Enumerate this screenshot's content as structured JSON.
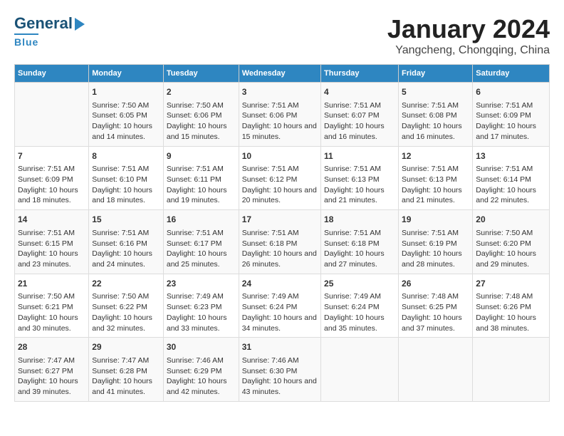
{
  "header": {
    "logo_line1": "General",
    "logo_line2": "Blue",
    "title": "January 2024",
    "subtitle": "Yangcheng, Chongqing, China"
  },
  "columns": [
    "Sunday",
    "Monday",
    "Tuesday",
    "Wednesday",
    "Thursday",
    "Friday",
    "Saturday"
  ],
  "weeks": [
    [
      {
        "day": "",
        "info": ""
      },
      {
        "day": "1",
        "info": "Sunrise: 7:50 AM\nSunset: 6:05 PM\nDaylight: 10 hours and 14 minutes."
      },
      {
        "day": "2",
        "info": "Sunrise: 7:50 AM\nSunset: 6:06 PM\nDaylight: 10 hours and 15 minutes."
      },
      {
        "day": "3",
        "info": "Sunrise: 7:51 AM\nSunset: 6:06 PM\nDaylight: 10 hours and 15 minutes."
      },
      {
        "day": "4",
        "info": "Sunrise: 7:51 AM\nSunset: 6:07 PM\nDaylight: 10 hours and 16 minutes."
      },
      {
        "day": "5",
        "info": "Sunrise: 7:51 AM\nSunset: 6:08 PM\nDaylight: 10 hours and 16 minutes."
      },
      {
        "day": "6",
        "info": "Sunrise: 7:51 AM\nSunset: 6:09 PM\nDaylight: 10 hours and 17 minutes."
      }
    ],
    [
      {
        "day": "7",
        "info": "Sunrise: 7:51 AM\nSunset: 6:09 PM\nDaylight: 10 hours and 18 minutes."
      },
      {
        "day": "8",
        "info": "Sunrise: 7:51 AM\nSunset: 6:10 PM\nDaylight: 10 hours and 18 minutes."
      },
      {
        "day": "9",
        "info": "Sunrise: 7:51 AM\nSunset: 6:11 PM\nDaylight: 10 hours and 19 minutes."
      },
      {
        "day": "10",
        "info": "Sunrise: 7:51 AM\nSunset: 6:12 PM\nDaylight: 10 hours and 20 minutes."
      },
      {
        "day": "11",
        "info": "Sunrise: 7:51 AM\nSunset: 6:13 PM\nDaylight: 10 hours and 21 minutes."
      },
      {
        "day": "12",
        "info": "Sunrise: 7:51 AM\nSunset: 6:13 PM\nDaylight: 10 hours and 21 minutes."
      },
      {
        "day": "13",
        "info": "Sunrise: 7:51 AM\nSunset: 6:14 PM\nDaylight: 10 hours and 22 minutes."
      }
    ],
    [
      {
        "day": "14",
        "info": "Sunrise: 7:51 AM\nSunset: 6:15 PM\nDaylight: 10 hours and 23 minutes."
      },
      {
        "day": "15",
        "info": "Sunrise: 7:51 AM\nSunset: 6:16 PM\nDaylight: 10 hours and 24 minutes."
      },
      {
        "day": "16",
        "info": "Sunrise: 7:51 AM\nSunset: 6:17 PM\nDaylight: 10 hours and 25 minutes."
      },
      {
        "day": "17",
        "info": "Sunrise: 7:51 AM\nSunset: 6:18 PM\nDaylight: 10 hours and 26 minutes."
      },
      {
        "day": "18",
        "info": "Sunrise: 7:51 AM\nSunset: 6:18 PM\nDaylight: 10 hours and 27 minutes."
      },
      {
        "day": "19",
        "info": "Sunrise: 7:51 AM\nSunset: 6:19 PM\nDaylight: 10 hours and 28 minutes."
      },
      {
        "day": "20",
        "info": "Sunrise: 7:50 AM\nSunset: 6:20 PM\nDaylight: 10 hours and 29 minutes."
      }
    ],
    [
      {
        "day": "21",
        "info": "Sunrise: 7:50 AM\nSunset: 6:21 PM\nDaylight: 10 hours and 30 minutes."
      },
      {
        "day": "22",
        "info": "Sunrise: 7:50 AM\nSunset: 6:22 PM\nDaylight: 10 hours and 32 minutes."
      },
      {
        "day": "23",
        "info": "Sunrise: 7:49 AM\nSunset: 6:23 PM\nDaylight: 10 hours and 33 minutes."
      },
      {
        "day": "24",
        "info": "Sunrise: 7:49 AM\nSunset: 6:24 PM\nDaylight: 10 hours and 34 minutes."
      },
      {
        "day": "25",
        "info": "Sunrise: 7:49 AM\nSunset: 6:24 PM\nDaylight: 10 hours and 35 minutes."
      },
      {
        "day": "26",
        "info": "Sunrise: 7:48 AM\nSunset: 6:25 PM\nDaylight: 10 hours and 37 minutes."
      },
      {
        "day": "27",
        "info": "Sunrise: 7:48 AM\nSunset: 6:26 PM\nDaylight: 10 hours and 38 minutes."
      }
    ],
    [
      {
        "day": "28",
        "info": "Sunrise: 7:47 AM\nSunset: 6:27 PM\nDaylight: 10 hours and 39 minutes."
      },
      {
        "day": "29",
        "info": "Sunrise: 7:47 AM\nSunset: 6:28 PM\nDaylight: 10 hours and 41 minutes."
      },
      {
        "day": "30",
        "info": "Sunrise: 7:46 AM\nSunset: 6:29 PM\nDaylight: 10 hours and 42 minutes."
      },
      {
        "day": "31",
        "info": "Sunrise: 7:46 AM\nSunset: 6:30 PM\nDaylight: 10 hours and 43 minutes."
      },
      {
        "day": "",
        "info": ""
      },
      {
        "day": "",
        "info": ""
      },
      {
        "day": "",
        "info": ""
      }
    ]
  ]
}
